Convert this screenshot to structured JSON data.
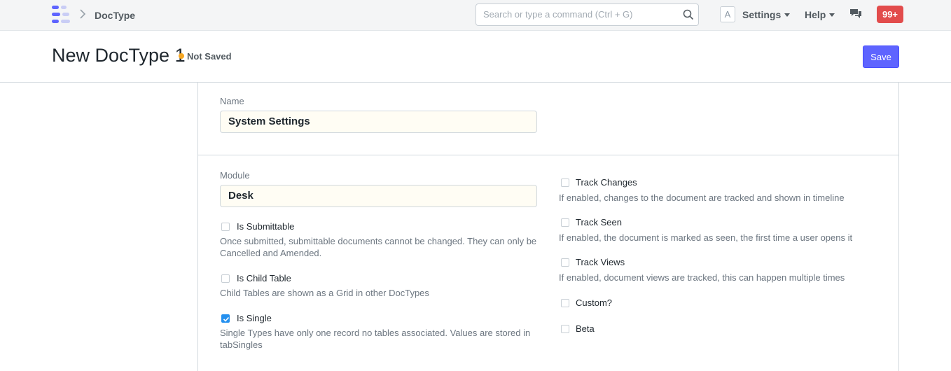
{
  "navbar": {
    "breadcrumb": "DocType",
    "search_placeholder": "Search or type a command (Ctrl + G)",
    "avatar_letter": "A",
    "settings_label": "Settings",
    "help_label": "Help",
    "notifications_count": "99+"
  },
  "page": {
    "title": "New DocType 1",
    "status": "Not Saved",
    "save_label": "Save"
  },
  "form": {
    "name_label": "Name",
    "name_value": "System Settings",
    "module_label": "Module",
    "module_value": "Desk",
    "left_checks": [
      {
        "label": "Is Submittable",
        "checked": false,
        "description": "Once submitted, submittable documents cannot be changed. They can only be Cancelled and Amended."
      },
      {
        "label": "Is Child Table",
        "checked": false,
        "description": "Child Tables are shown as a Grid in other DocTypes"
      },
      {
        "label": "Is Single",
        "checked": true,
        "description": "Single Types have only one record no tables associated. Values are stored in tabSingles"
      }
    ],
    "right_checks": [
      {
        "label": "Track Changes",
        "checked": false,
        "description": "If enabled, changes to the document are tracked and shown in timeline"
      },
      {
        "label": "Track Seen",
        "checked": false,
        "description": "If enabled, the document is marked as seen, the first time a user opens it"
      },
      {
        "label": "Track Views",
        "checked": false,
        "description": "If enabled, document views are tracked, this can happen multiple times"
      },
      {
        "label": "Custom?",
        "checked": false,
        "description": ""
      },
      {
        "label": "Beta",
        "checked": false,
        "description": ""
      }
    ]
  }
}
